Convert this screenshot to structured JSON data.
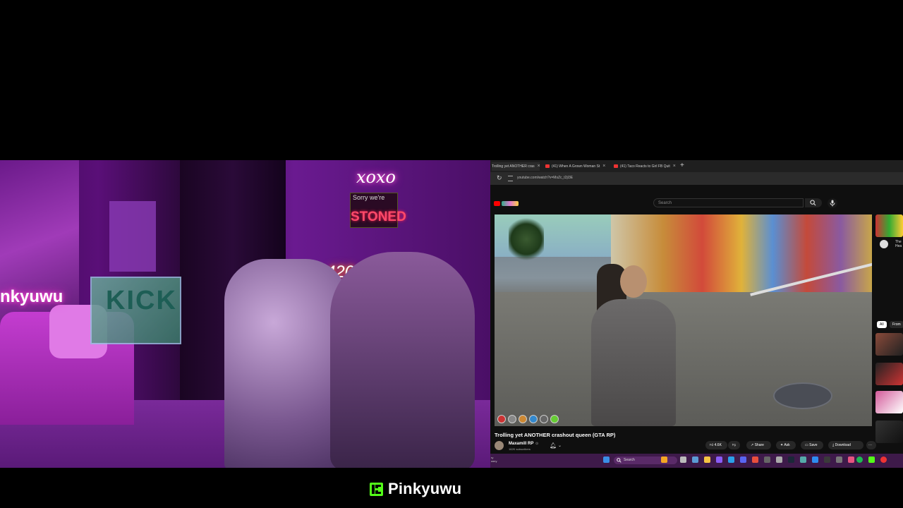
{
  "webcam": {
    "neon_left": "nkyuwu",
    "neon_xoxo": "xoxo",
    "sign_top_text": "Sorry we're",
    "sign_stoned": "STONED",
    "neon_420": "420",
    "kick_sign": "KICK"
  },
  "browser": {
    "tabs": [
      {
        "label": "Trolling yet ANOTHER cras",
        "active": true
      },
      {
        "label": "(41) When A Grown Woman St",
        "active": false
      },
      {
        "label": "(41) Taco Reacts to Girl FB Quit",
        "active": false
      }
    ],
    "new_tab_symbol": "+",
    "url": "youtube.com/watch?v=MsZc_t2jI3E"
  },
  "youtube": {
    "search_placeholder": "Search",
    "video_title": "Trolling yet ANOTHER crashout queen (GTA RP)",
    "channel_name": "Maxamill RP",
    "verified_symbol": "⊙",
    "subscribers": "162K subscribers",
    "likes": "4.6K",
    "share_label": "Share",
    "ask_label": "Ask",
    "save_label": "Save",
    "download_label": "Download",
    "more_label": "···",
    "chip_all": "All",
    "chip_from": "From",
    "sidebar_snippet": "The Hea"
  },
  "taskbar": {
    "search_label": "Search",
    "left_text": "ry\nwery"
  },
  "branding": {
    "streamer_name": "Pinkyuwu",
    "platform_color": "#53fc18"
  },
  "colors": {
    "youtube_red": "#ff0000",
    "kick_green": "#53fc18",
    "taskbar_purple": "#3e1a4a"
  }
}
